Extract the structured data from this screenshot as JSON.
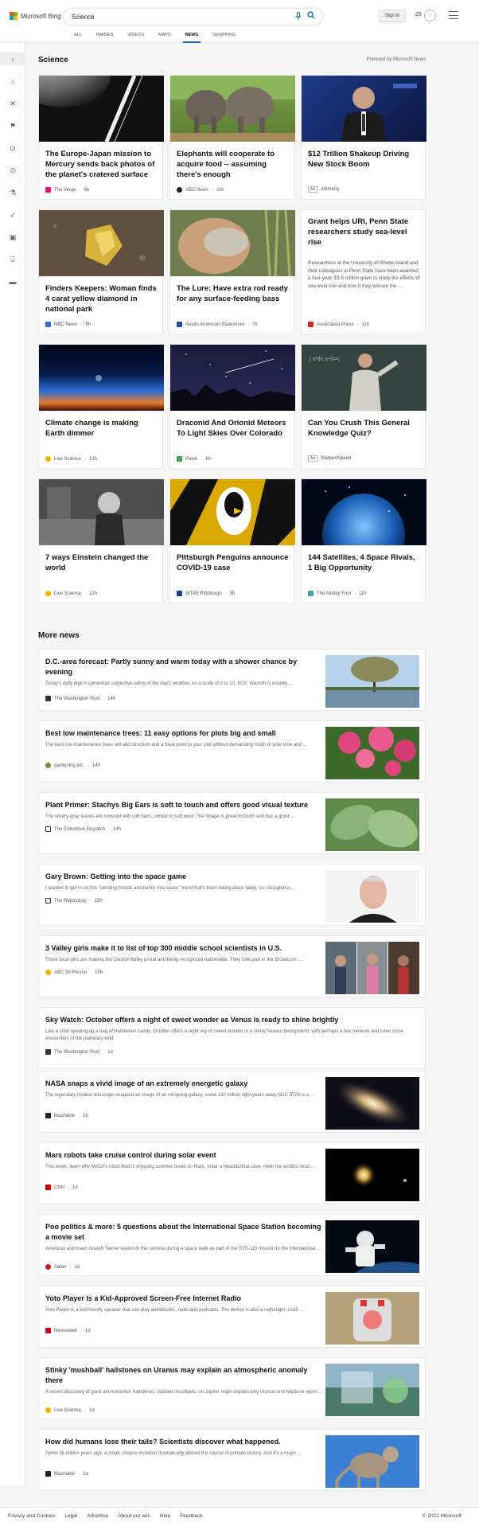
{
  "header": {
    "brand": "Microsoft Bing",
    "search_value": "Science",
    "signin_label": "Sign in",
    "points": "25",
    "tabs": [
      {
        "label": "ALL"
      },
      {
        "label": "IMAGES"
      },
      {
        "label": "VIDEOS"
      },
      {
        "label": "MAPS"
      },
      {
        "label": "NEWS"
      },
      {
        "label": "SHOPPING"
      }
    ],
    "active_tab": "NEWS"
  },
  "section": {
    "title": "Science",
    "powered_by": "Powered by Microsoft News"
  },
  "cards": [
    {
      "title": "The Europe-Japan mission to Mercury sends back photos of the planet's cratered surface",
      "source": "The Verge",
      "age": "6h"
    },
    {
      "title": "Elephants will cooperate to acquire food -- assuming there's enough",
      "source": "ABC News",
      "age": "11h"
    },
    {
      "title": "$12 Trillion Shakeup Driving New Stock Boom",
      "ad": "Ad",
      "source": "Altimetry"
    },
    {
      "title": "Finders Keepers: Woman finds 4 carat yellow diamond in national park",
      "source": "NBC News",
      "age": "5h"
    },
    {
      "title": "The Lure: Have extra rod ready for any surface-feeding bass",
      "source": "Austin American-Statesman",
      "age": "7h"
    },
    {
      "title": "Grant helps URI, Penn State researchers study sea-level rise",
      "snippet": "Researchers at the University of Rhode Island and their colleagues at Penn State have been awarded a four-year, $1.5 million grant to study the effects of sea level rise and how it may worsen the ...",
      "source": "Associated Press",
      "age": "11h"
    },
    {
      "title": "Climate change is making Earth dimmer",
      "source": "Live Science",
      "age": "12h"
    },
    {
      "title": "Draconid And Orionid Meteors To Light Skies Over Colorado",
      "source": "Patch",
      "age": "8h"
    },
    {
      "title": "Can You Crush This General Knowledge Quiz?",
      "ad": "Ad",
      "source": "WarpedSpeed"
    },
    {
      "title": "7 ways Einstein changed the world",
      "source": "Live Science",
      "age": "12h"
    },
    {
      "title": "Pittsburgh Penguins announce COVID-19 case",
      "source": "WTAE Pittsburgh",
      "age": "9h"
    },
    {
      "title": "144 Satellites, 4 Space Rivals, 1 Big Opportunity",
      "source": "The Motley Fool",
      "age": "11h"
    }
  ],
  "more_news": {
    "title": "More news",
    "items": [
      {
        "title": "D.C.-area forecast: Partly sunny and warm today with a shower chance by evening",
        "snippet": "Today's daily digit A somewhat subjective rating of the day's weather, on a scale of 0 to 10. 6/10: Warmth is notably ...",
        "source": "The Washington Post",
        "age": "14h"
      },
      {
        "title": "Best low maintenance trees: 11 easy options for plots big and small",
        "snippet": "The best low maintenance trees will add structure and a focal point to your plot without demanding much of your time and ...",
        "source": "gardening etc.",
        "age": "14h"
      },
      {
        "title": "Plant Primer: Stachys Big Ears is soft to touch and offers good visual texture",
        "snippet": "The silvery-gray leaves are covered with soft hairs, similar to soft wool. The foliage is great to touch and has a good ...",
        "source": "The Columbus Dispatch",
        "age": "14h"
      },
      {
        "title": "Gary Brown: Getting into the space game",
        "snippet": "I wanted to get in on this \"sending friends and family into space\" trend that's been taking place lately, so I Googled a ...",
        "source": "The Repository",
        "age": "15h"
      },
      {
        "title": "3 Valley girls make it to list of top 300 middle school scientists in U.S.",
        "snippet": "Three local girls are making the Central Valley proud and being recognized nationwide. They took part in the Broadcom ...",
        "source": "ABC 30 Fresno",
        "age": "19h"
      },
      {
        "title": "Sky Watch: October offers a night of sweet wonder as Venus is ready to shine brightly",
        "snippet": "Like a child opening up a bag of Halloween candy, October offers a night sky of sweet wonder in a starry heaven background, with perhaps a few meteors and lunar close encounters of the planetary kind.",
        "source": "The Washington Post",
        "age": "1d"
      },
      {
        "title": "NASA snaps a vivid image of an extremely energetic galaxy",
        "snippet": "The legendary Hubble telescope snapped an image of an intriguing galaxy, some 130 million light-years away.NGC 5728 is a ...",
        "source": "Mashable",
        "age": "1d"
      },
      {
        "title": "Mars robots take cruise control during solar event",
        "snippet": "This week, learn why NASA's robot fleet is enjoying summer break on Mars, enter a Neanderthal cave, meet the world's most ...",
        "source": "CNN",
        "age": "1d"
      },
      {
        "title": "Poo politics & more: 5 questions about the International Space Station becoming a movie set",
        "snippet": "American astronaut Joseph Tanner waves to the camera during a space walk as part of the STS-115 mission to the International ...",
        "source": "Salon",
        "age": "1d"
      },
      {
        "title": "Yoto Player Is a Kid-Approved Screen-Free Internet Radio",
        "snippet": "Yoto Player is a kid-friendly speaker that can play audiobooks, radio and podcasts. The device is also a night-light, clock ...",
        "source": "Newsweek",
        "age": "1d"
      },
      {
        "title": "Stinky 'mushball' hailstones on Uranus may explain an atmospheric anomaly there",
        "snippet": "A recent discovery of giant ammonia-rich hailstones, dubbed mushballs, on Jupiter might explain why Uranus and Neptune seem ...",
        "source": "Live Science",
        "age": "1d"
      },
      {
        "title": "How did humans lose their tails? Scientists discover what happened.",
        "snippet": "Some 25 million years ago, a small, chance mutation dramatically altered the course of primate history. And it's a major ...",
        "source": "Mashable",
        "age": "1d"
      }
    ]
  },
  "footer": {
    "links": [
      "Privacy and Cookies",
      "Legal",
      "Advertise",
      "About our ads",
      "Help",
      "Feedback"
    ],
    "copyright": "© 2021 Microsoft"
  }
}
